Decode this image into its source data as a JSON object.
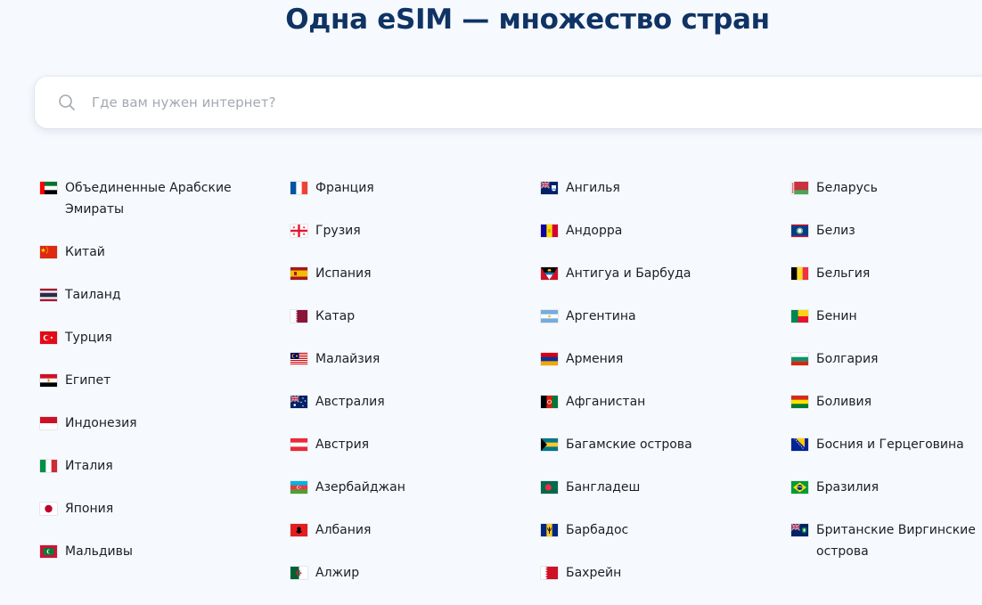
{
  "header": {
    "title": "Одна eSIM — множество стран"
  },
  "search": {
    "placeholder": "Где вам нужен интернет?",
    "value": ""
  },
  "countries": {
    "col1": [
      {
        "name": "Объединенные Арабские Эмираты",
        "flag": "ae"
      },
      {
        "name": "Китай",
        "flag": "cn"
      },
      {
        "name": "Таиланд",
        "flag": "th"
      },
      {
        "name": "Турция",
        "flag": "tr"
      },
      {
        "name": "Египет",
        "flag": "eg"
      },
      {
        "name": "Индонезия",
        "flag": "id"
      },
      {
        "name": "Италия",
        "flag": "it"
      },
      {
        "name": "Япония",
        "flag": "jp"
      },
      {
        "name": "Мальдивы",
        "flag": "mv"
      }
    ],
    "col2": [
      {
        "name": "Франция",
        "flag": "fr"
      },
      {
        "name": "Грузия",
        "flag": "ge"
      },
      {
        "name": "Испания",
        "flag": "es"
      },
      {
        "name": "Катар",
        "flag": "qa"
      },
      {
        "name": "Малайзия",
        "flag": "my"
      },
      {
        "name": "Австралия",
        "flag": "au"
      },
      {
        "name": "Австрия",
        "flag": "at"
      },
      {
        "name": "Азербайджан",
        "flag": "az"
      },
      {
        "name": "Албания",
        "flag": "al"
      },
      {
        "name": "Алжир",
        "flag": "dz"
      }
    ],
    "col3": [
      {
        "name": "Ангилья",
        "flag": "ai"
      },
      {
        "name": "Андорра",
        "flag": "ad"
      },
      {
        "name": "Антигуа и Барбуда",
        "flag": "ag"
      },
      {
        "name": "Аргентина",
        "flag": "ar"
      },
      {
        "name": "Армения",
        "flag": "am"
      },
      {
        "name": "Афганистан",
        "flag": "af"
      },
      {
        "name": "Багамские острова",
        "flag": "bs"
      },
      {
        "name": "Бангладеш",
        "flag": "bd"
      },
      {
        "name": "Барбадос",
        "flag": "bb"
      },
      {
        "name": "Бахрейн",
        "flag": "bh"
      }
    ],
    "col4": [
      {
        "name": "Беларусь",
        "flag": "by"
      },
      {
        "name": "Белиз",
        "flag": "bz"
      },
      {
        "name": "Бельгия",
        "flag": "be"
      },
      {
        "name": "Бенин",
        "flag": "bj"
      },
      {
        "name": "Болгария",
        "flag": "bg"
      },
      {
        "name": "Боливия",
        "flag": "bo"
      },
      {
        "name": "Босния и Герцеговина",
        "flag": "ba"
      },
      {
        "name": "Бразилия",
        "flag": "br"
      },
      {
        "name": "Британские Виргинские острова",
        "flag": "vg"
      }
    ]
  },
  "colors": {
    "title": "#0f3364",
    "text": "#1c1f24",
    "placeholder": "#a3a9b1",
    "background": "#f6f9fd"
  }
}
